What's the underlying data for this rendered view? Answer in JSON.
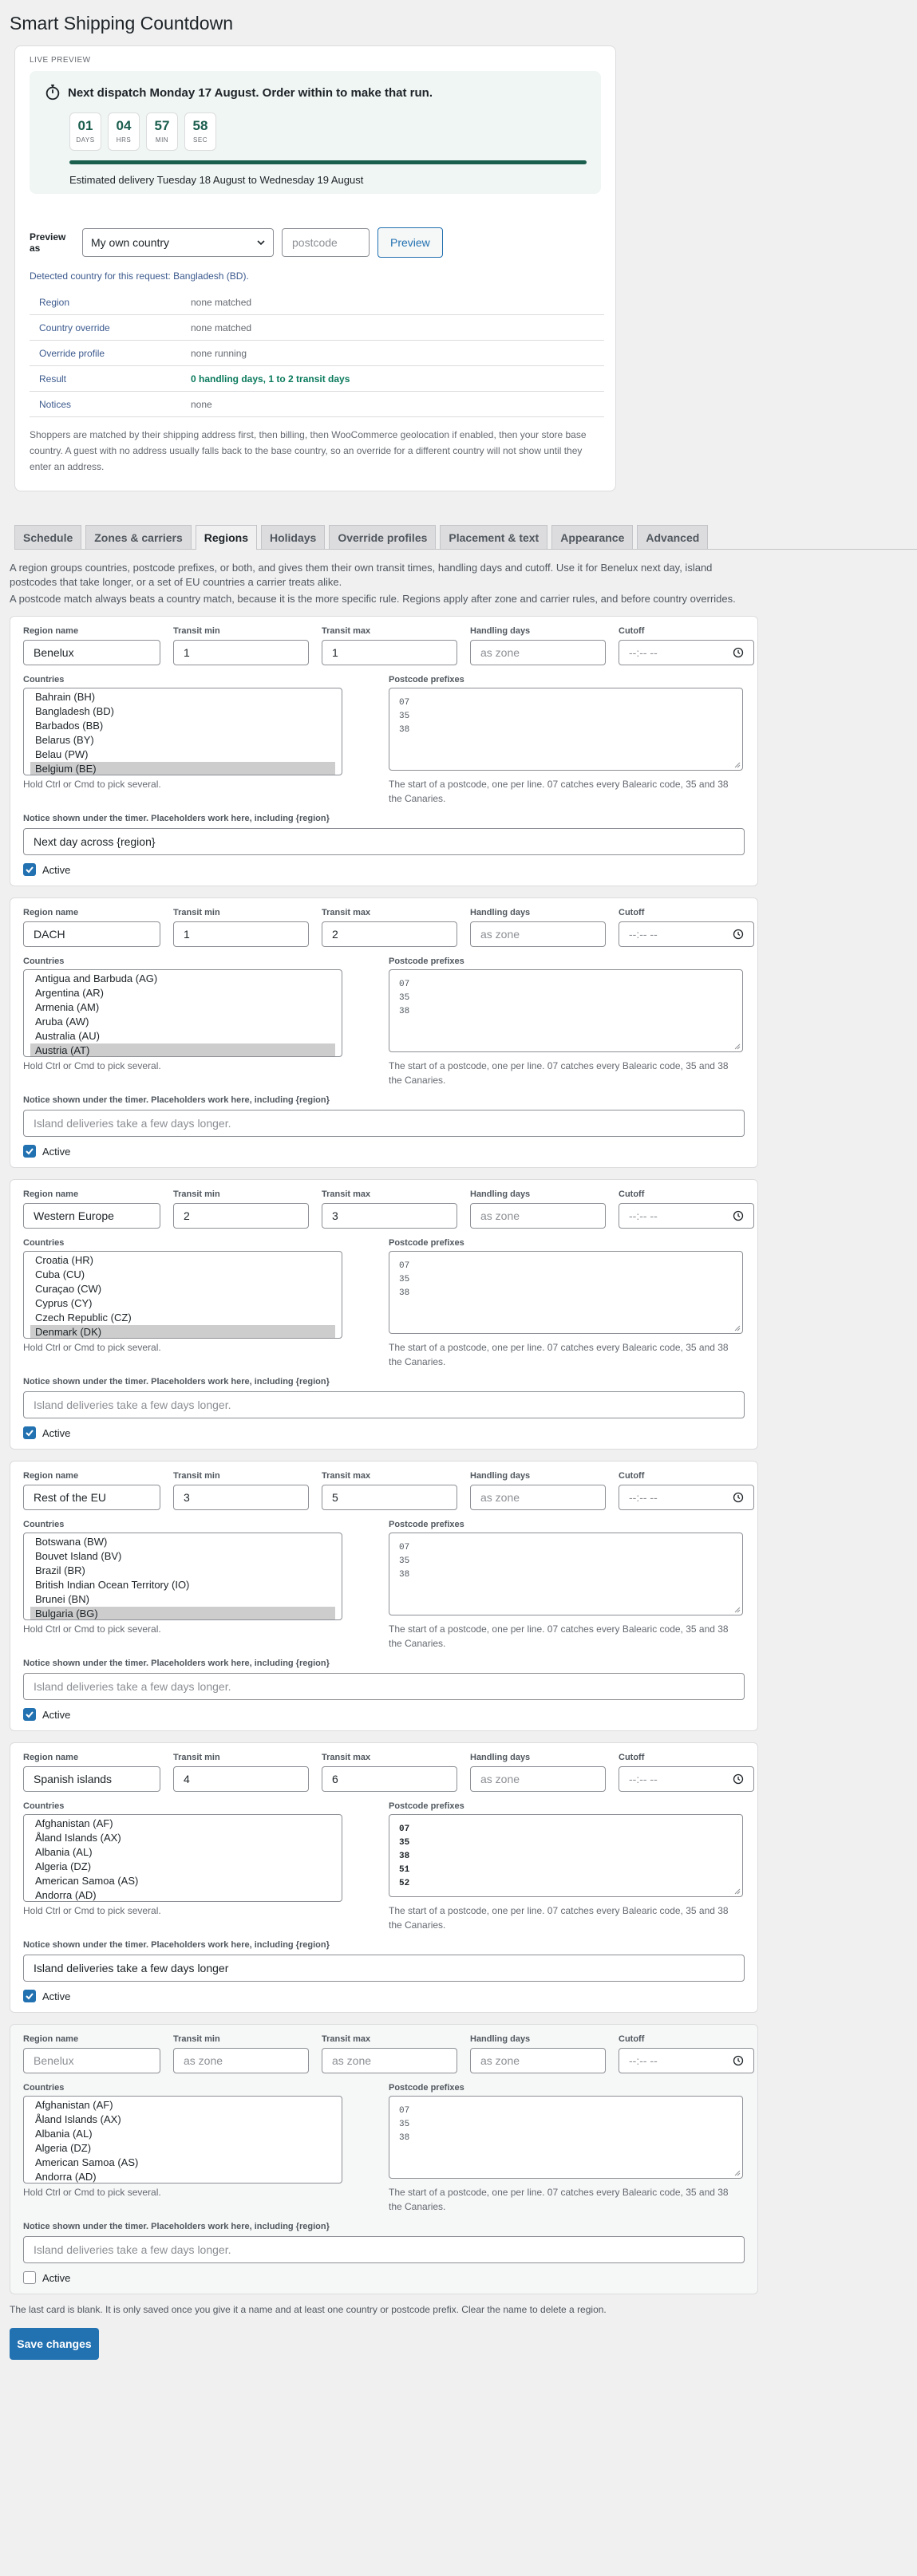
{
  "page_title": "Smart Shipping Countdown",
  "preview": {
    "label": "LIVE PREVIEW",
    "headline": "Next dispatch Monday 17 August. Order within to make that run.",
    "countdown": [
      {
        "value": "01",
        "unit": "DAYS"
      },
      {
        "value": "04",
        "unit": "HRS"
      },
      {
        "value": "57",
        "unit": "MIN"
      },
      {
        "value": "58",
        "unit": "SEC"
      }
    ],
    "progress_fraction": 1.0,
    "estimated": "Estimated delivery Tuesday 18 August to Wednesday 19 August",
    "preview_as_label": "Preview as",
    "preview_as_value": "My own country",
    "postcode_placeholder": "postcode",
    "preview_button": "Preview",
    "detected": "Detected country for this request: Bangladesh (BD).",
    "rows": [
      {
        "key": "Region",
        "value": "none matched"
      },
      {
        "key": "Country override",
        "value": "none matched"
      },
      {
        "key": "Override profile",
        "value": "none running"
      },
      {
        "key": "Result",
        "value": "0 handling days, 1 to 2 transit days"
      },
      {
        "key": "Notices",
        "value": "none"
      }
    ],
    "note": "Shoppers are matched by their shipping address first, then billing, then WooCommerce geolocation if enabled, then your store base country. A guest with no address usually falls back to the base country, so an override for a different country will not show until they enter an address."
  },
  "tabs": [
    "Schedule",
    "Zones & carriers",
    "Regions",
    "Holidays",
    "Override profiles",
    "Placement & text",
    "Appearance",
    "Advanced"
  ],
  "active_tab": "Regions",
  "intro": "A region groups countries, postcode prefixes, or both, and gives them their own transit times, handling days and cutoff. Use it for Benelux next day, island postcodes that take longer, or a set of EU countries a carrier treats alike.",
  "intro2": "A postcode match always beats a country match, because it is the more specific rule. Regions apply after zone and carrier rules, and before country overrides.",
  "labels": {
    "region_name": "Region name",
    "transit_min": "Transit min",
    "transit_max": "Transit max",
    "handling_days": "Handling days",
    "cutoff": "Cutoff",
    "countries": "Countries",
    "postcode_prefixes": "Postcode prefixes",
    "countries_hint": "Hold Ctrl or Cmd to pick several.",
    "postcode_hint": "The start of a postcode, one per line. 07 catches every Balearic code, 35 and 38 the Canaries.",
    "notice_label": "Notice shown under the timer. Placeholders work here, including {region}",
    "active": "Active",
    "as_zone": "as zone",
    "cutoff_ph": "--:-- --"
  },
  "regions": [
    {
      "name": "Benelux",
      "min": "1",
      "max": "1",
      "countries": [
        "Bahrain (BH)",
        "Bangladesh (BD)",
        "Barbados (BB)",
        "Belarus (BY)",
        "Belau (PW)",
        "Belgium (BE)"
      ],
      "selected": 5,
      "postcodes": [
        "07",
        "35",
        "38"
      ],
      "postcodes_filled": false,
      "notice": "Next day across {region}",
      "notice_placeholder": "",
      "active": true
    },
    {
      "name": "DACH",
      "min": "1",
      "max": "2",
      "countries": [
        "Antigua and Barbuda (AG)",
        "Argentina (AR)",
        "Armenia (AM)",
        "Aruba (AW)",
        "Australia (AU)",
        "Austria (AT)"
      ],
      "selected": 5,
      "postcodes": [
        "07",
        "35",
        "38"
      ],
      "postcodes_filled": false,
      "notice": "",
      "notice_placeholder": "Island deliveries take a few days longer.",
      "active": true
    },
    {
      "name": "Western Europe",
      "min": "2",
      "max": "3",
      "countries": [
        "Croatia (HR)",
        "Cuba (CU)",
        "Curaçao (CW)",
        "Cyprus (CY)",
        "Czech Republic (CZ)",
        "Denmark (DK)"
      ],
      "selected": 5,
      "postcodes": [
        "07",
        "35",
        "38"
      ],
      "postcodes_filled": false,
      "notice": "",
      "notice_placeholder": "Island deliveries take a few days longer.",
      "active": true
    },
    {
      "name": "Rest of the EU",
      "min": "3",
      "max": "5",
      "countries": [
        "Botswana (BW)",
        "Bouvet Island (BV)",
        "Brazil (BR)",
        "British Indian Ocean Territory (IO)",
        "Brunei (BN)",
        "Bulgaria (BG)"
      ],
      "selected": 5,
      "postcodes": [
        "07",
        "35",
        "38"
      ],
      "postcodes_filled": false,
      "notice": "",
      "notice_placeholder": "Island deliveries take a few days longer.",
      "active": true
    },
    {
      "name": "Spanish islands",
      "min": "4",
      "max": "6",
      "countries": [
        "Afghanistan (AF)",
        "Åland Islands (AX)",
        "Albania (AL)",
        "Algeria (DZ)",
        "American Samoa (AS)",
        "Andorra (AD)"
      ],
      "selected": -1,
      "postcodes": [
        "07",
        "35",
        "38",
        "51",
        "52"
      ],
      "postcodes_filled": true,
      "notice": "Island deliveries take a few days longer",
      "notice_placeholder": "",
      "active": true
    },
    {
      "name": "",
      "name_placeholder": "Benelux",
      "min": "",
      "max": "",
      "countries": [
        "Afghanistan (AF)",
        "Åland Islands (AX)",
        "Albania (AL)",
        "Algeria (DZ)",
        "American Samoa (AS)",
        "Andorra (AD)"
      ],
      "selected": -1,
      "postcodes": [
        "07",
        "35",
        "38"
      ],
      "postcodes_filled": false,
      "notice": "",
      "notice_placeholder": "Island deliveries take a few days longer.",
      "active": false,
      "blank": true
    }
  ],
  "footer_note": "The last card is blank. It is only saved once you give it a name and at least one country or postcode prefix. Clear the name to delete a region.",
  "save_button": "Save changes",
  "colors": {
    "accent": "#2271b1",
    "timer": "#1a5e4e",
    "good": "#0a7a5c"
  }
}
